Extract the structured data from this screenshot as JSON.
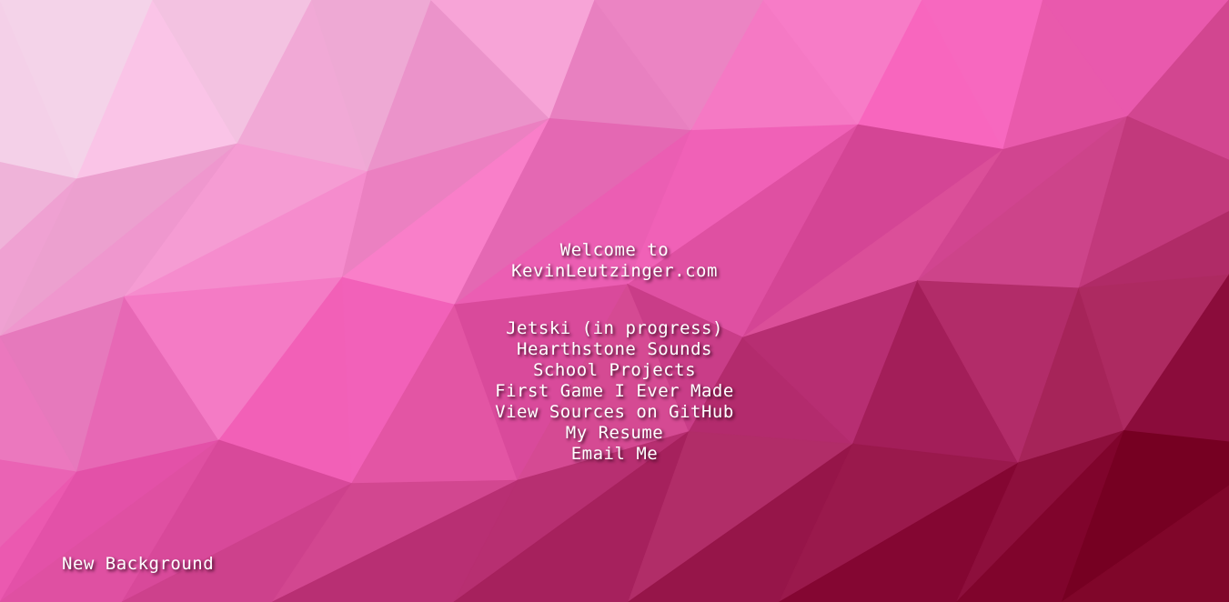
{
  "background": {
    "style": "low-poly triangles",
    "colors": {
      "top_left": "#f6eef6",
      "center": "#ee5cb4",
      "bottom_right": "#7a0024"
    }
  },
  "welcome": {
    "line1": "Welcome to",
    "line2": "KevinLeutzinger.com"
  },
  "links": [
    {
      "label": "Jetski (in progress)"
    },
    {
      "label": "Hearthstone Sounds"
    },
    {
      "label": "School Projects"
    },
    {
      "label": "First Game I Ever Made"
    },
    {
      "label": "View Sources on GitHub"
    },
    {
      "label": "My Resume"
    },
    {
      "label": "Email Me"
    }
  ],
  "footer": {
    "new_background_label": "New Background"
  }
}
